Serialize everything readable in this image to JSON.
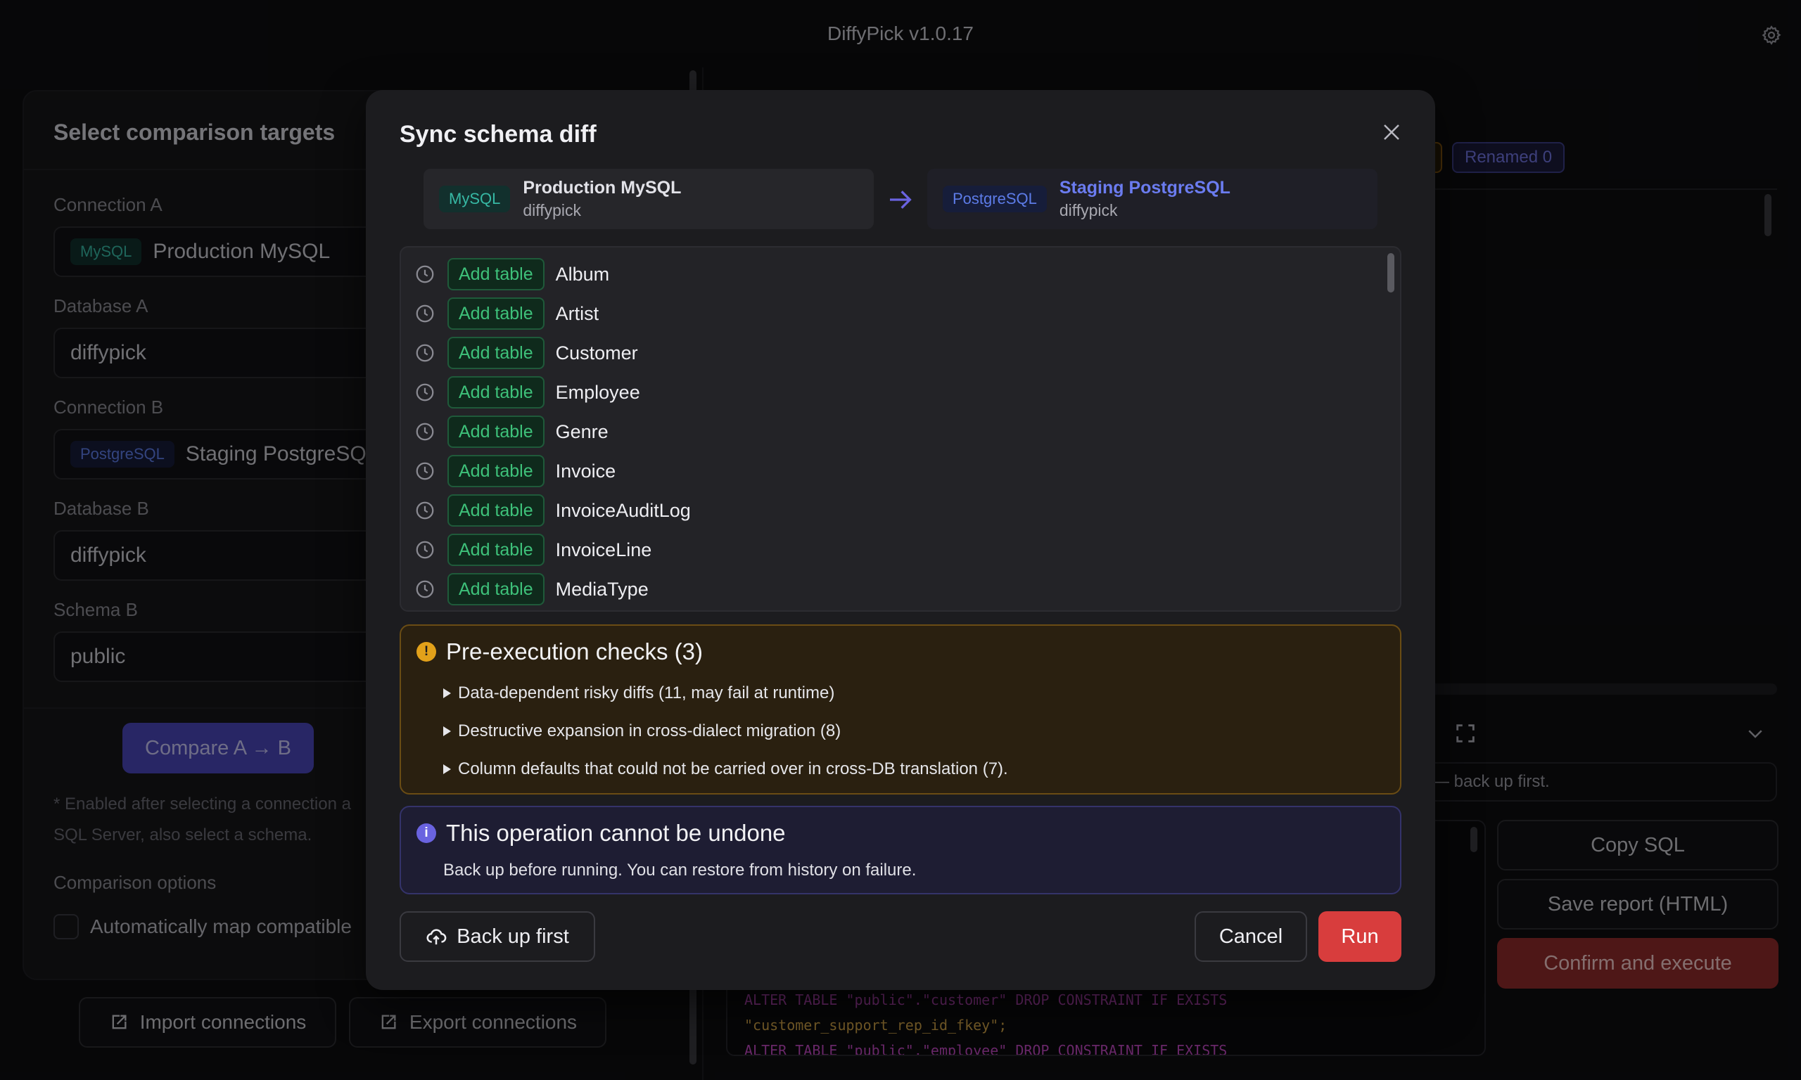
{
  "app": {
    "title": "DiffyPick v1.0.17"
  },
  "left_panel": {
    "title": "Select comparison targets",
    "connection_a": {
      "label": "Connection A",
      "tag": "MySQL",
      "value": "Production MySQL"
    },
    "database_a": {
      "label": "Database A",
      "value": "diffypick"
    },
    "connection_b": {
      "label": "Connection B",
      "tag": "PostgreSQL",
      "value": "Staging PostgreSQ"
    },
    "database_b": {
      "label": "Database B",
      "value": "diffypick"
    },
    "schema_b": {
      "label": "Schema B",
      "value": "public"
    },
    "compare_button": "Compare A → B",
    "hint_line1": "* Enabled after selecting a connection a",
    "hint_line2": "SQL Server, also select a schema.",
    "options_title": "Comparison options",
    "auto_map_label": "Automatically map compatible",
    "import_button": "Import connections",
    "export_button": "Export connections"
  },
  "right_panel": {
    "renamed_badge": "Renamed 0",
    "warning_strip": "— back up first.",
    "code_lines": [
      "ALTER TABLE \"public\".\"customer\" DROP CONSTRAINT IF EXISTS",
      "\"customer_support_rep_id_fkey\";",
      "ALTER TABLE \"public\".\"employee\" DROP CONSTRAINT IF EXISTS"
    ],
    "copy_sql_button": "Copy SQL",
    "save_report_button": "Save report (HTML)",
    "confirm_button": "Confirm and execute"
  },
  "modal": {
    "title": "Sync schema diff",
    "source": {
      "tag": "MySQL",
      "name": "Production MySQL",
      "db": "diffypick"
    },
    "target": {
      "tag": "PostgreSQL",
      "name": "Staging PostgreSQL",
      "db": "diffypick"
    },
    "diff_items": [
      {
        "action": "Add table",
        "name": "Album"
      },
      {
        "action": "Add table",
        "name": "Artist"
      },
      {
        "action": "Add table",
        "name": "Customer"
      },
      {
        "action": "Add table",
        "name": "Employee"
      },
      {
        "action": "Add table",
        "name": "Genre"
      },
      {
        "action": "Add table",
        "name": "Invoice"
      },
      {
        "action": "Add table",
        "name": "InvoiceAuditLog"
      },
      {
        "action": "Add table",
        "name": "InvoiceLine"
      },
      {
        "action": "Add table",
        "name": "MediaType"
      }
    ],
    "checks": {
      "title": "Pre-execution checks (3)",
      "items": [
        "Data-dependent risky diffs (11, may fail at runtime)",
        "Destructive expansion in cross-dialect migration (8)",
        "Column defaults that could not be carried over in cross-DB translation (7)."
      ]
    },
    "info": {
      "title": "This operation cannot be undone",
      "text": "Back up before running. You can restore from history on failure."
    },
    "backup_button": "Back up first",
    "cancel_button": "Cancel",
    "run_button": "Run"
  },
  "colors": {
    "accent": "#4a45b8",
    "run": "#d83d3d",
    "confirm": "#8e2a2a",
    "add_badge": "#3ec17a",
    "warning": "#e2a11a",
    "info": "#6a63e0"
  }
}
